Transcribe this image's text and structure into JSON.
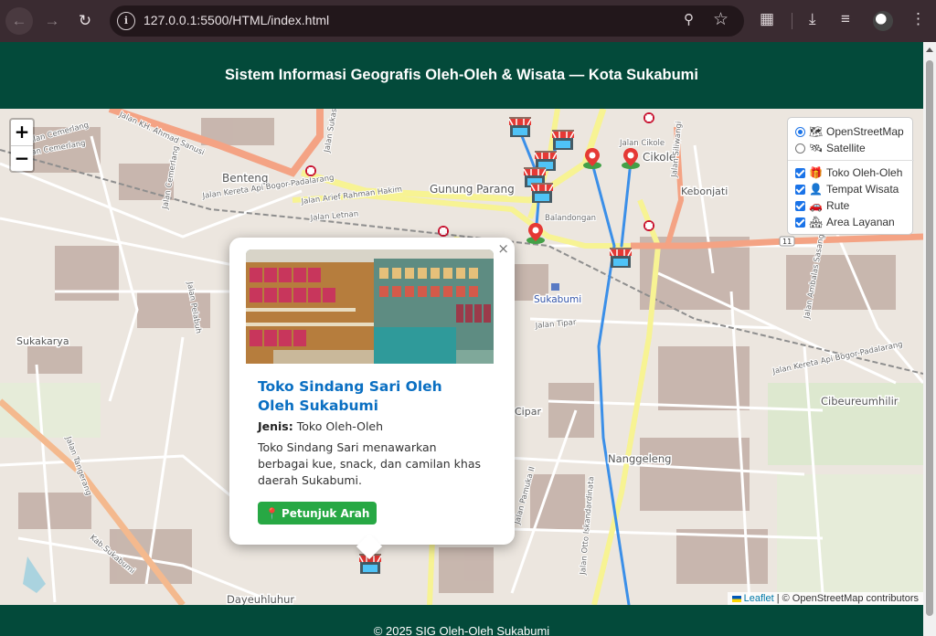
{
  "browser": {
    "url": "127.0.0.1:5500/HTML/index.html",
    "back_icon": "arrow-left",
    "forward_icon": "arrow-right",
    "reload_icon": "reload"
  },
  "header": {
    "title": "Sistem Informasi Geografis Oleh-Oleh & Wisata — Kota Sukabumi",
    "bg_color": "#034a3a"
  },
  "map": {
    "zoom_in": "+",
    "zoom_out": "−",
    "place_labels": [
      "Benteng",
      "Gunung Parang",
      "Cikole",
      "Kebonjati",
      "Sukabumi",
      "Sukakarya",
      "Cibeureumhilir",
      "Nanggeleng",
      "Dayeuhluhur",
      "Cipar"
    ],
    "street_labels": [
      "Jalan KH. Ahmad Sanusi",
      "Jalan Arief Rahman Hakim",
      "Jalan Kereta Api Bogor-Padalarang",
      "Jalan Letnan",
      "Jalan Cemerlang",
      "Jalan Otto Iskandardinata",
      "Jalan Tipar",
      "Jalan Ambalas Sasang",
      "Jalan Siliwangi",
      "Jalan Cikole",
      "Balandongan",
      "Jalan Kereta Api Bogor-Padalarang",
      "Jalan Cemerlang",
      "Kab.Sukabumi",
      "Jalan Tangerang",
      "Jalan Pelabuh",
      "Jalan Cemerlang",
      "Jalan Sukasari",
      "Jalan Pamuka II"
    ],
    "route_color": "#3b8fe8",
    "layers": {
      "base": [
        {
          "label": "OpenStreetMap",
          "selected": true,
          "icon": "map-icon"
        },
        {
          "label": "Satellite",
          "selected": false,
          "icon": "satellite-icon"
        }
      ],
      "overlays": [
        {
          "label": "Toko Oleh-Oleh",
          "checked": true,
          "icon": "gift-icon"
        },
        {
          "label": "Tempat Wisata",
          "checked": true,
          "icon": "person-icon"
        },
        {
          "label": "Rute",
          "checked": true,
          "icon": "car-icon"
        },
        {
          "label": "Area Layanan",
          "checked": true,
          "icon": "houses-icon"
        }
      ]
    },
    "attribution": {
      "leaflet": "Leaflet",
      "osm": "| © OpenStreetMap contributors"
    }
  },
  "popup": {
    "title": "Toko Sindang Sari Oleh Oleh Sukabumi",
    "type_label": "Jenis:",
    "type_value": "Toko Oleh-Oleh",
    "description": "Toko Sindang Sari menawarkan berbagai kue, snack, dan camilan khas daerah Sukabumi.",
    "button": "Petunjuk Arah",
    "button_icon": "pin-icon",
    "close": "×"
  },
  "footer": {
    "text": "© 2025 SIG Oleh-Oleh Sukabumi"
  }
}
